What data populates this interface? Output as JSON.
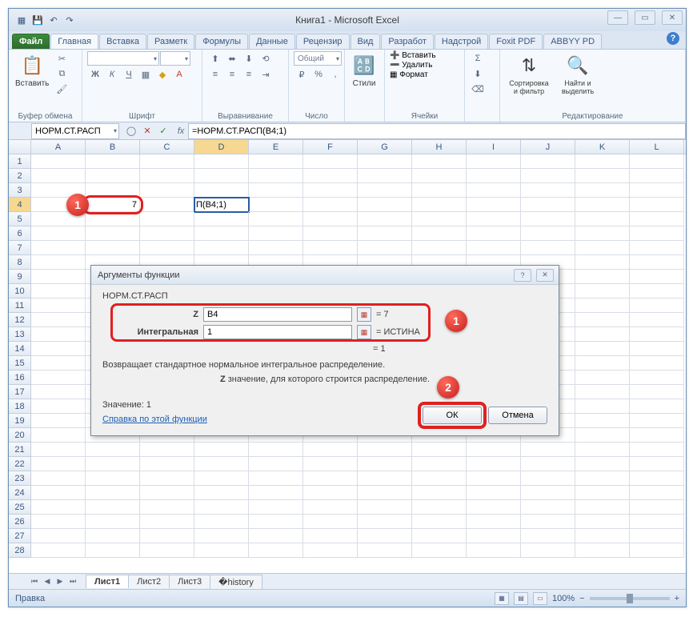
{
  "title_app": "Книга1  -  Microsoft Excel",
  "tabs": {
    "file": "Файл",
    "home": "Главная",
    "insert": "Вставка",
    "layout": "Разметк",
    "formulas": "Формулы",
    "data": "Данные",
    "review": "Рецензир",
    "view": "Вид",
    "developer": "Разработ",
    "addins": "Надстрой",
    "foxit": "Foxit PDF",
    "abbyy": "ABBYY PD"
  },
  "ribbon": {
    "paste": "Вставить",
    "clipboard": "Буфер обмена",
    "font": "Шрифт",
    "alignment": "Выравнивание",
    "number": "Число",
    "number_fmt": "Общий",
    "styles": "Стили",
    "cells": "Ячейки",
    "cell_insert": "Вставить",
    "cell_delete": "Удалить",
    "cell_format": "Формат",
    "editing": "Редактирование",
    "sort": "Сортировка и фильтр",
    "find": "Найти и выделить"
  },
  "namebox": "НОРМ.СТ.РАСП",
  "formula": "=НОРМ.СТ.РАСП(B4;1)",
  "columns": [
    "A",
    "B",
    "C",
    "D",
    "E",
    "F",
    "G",
    "H",
    "I",
    "J",
    "K",
    "L"
  ],
  "cell_b4": "7",
  "cell_d4": "П(B4;1)",
  "dialog": {
    "title": "Аргументы функции",
    "fname": "НОРМ.СТ.РАСП",
    "arg1_label": "Z",
    "arg1_value": "B4",
    "arg1_result": "=  7",
    "arg2_label": "Интегральная",
    "arg2_value": "1",
    "arg2_result": "=  ИСТИНА",
    "result_eq": "=  1",
    "desc1": "Возвращает стандартное нормальное интегральное распределение.",
    "desc2_b": "Z",
    "desc2_txt": "  значение, для которого строится распределение.",
    "value_label": "Значение:  1",
    "help": "Справка по этой функции",
    "ok": "ОК",
    "cancel": "Отмена"
  },
  "sheets": {
    "s1": "Лист1",
    "s2": "Лист2",
    "s3": "Лист3"
  },
  "status": "Правка",
  "zoom": "100%",
  "callouts": {
    "one": "1",
    "two": "2"
  }
}
